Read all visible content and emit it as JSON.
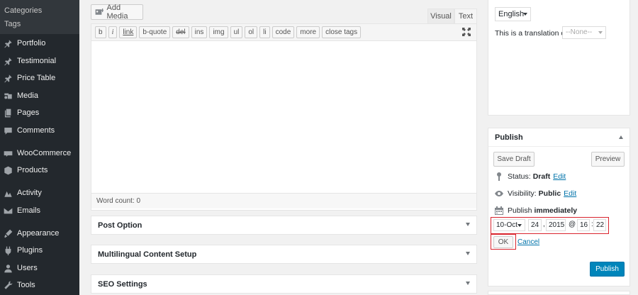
{
  "sidebar": {
    "sub_items": [
      "Categories",
      "Tags"
    ],
    "items": [
      {
        "label": "Portfolio",
        "icon": "pin-icon"
      },
      {
        "label": "Testimonial",
        "icon": "pin-icon"
      },
      {
        "label": "Price Table",
        "icon": "pin-icon"
      },
      {
        "label": "Media",
        "icon": "media-icon"
      },
      {
        "label": "Pages",
        "icon": "pages-icon"
      },
      {
        "label": "Comments",
        "icon": "comments-icon"
      },
      {
        "label": "WooCommerce",
        "icon": "woocommerce-icon"
      },
      {
        "label": "Products",
        "icon": "products-icon"
      },
      {
        "label": "Activity",
        "icon": "activity-icon"
      },
      {
        "label": "Emails",
        "icon": "email-icon"
      },
      {
        "label": "Appearance",
        "icon": "appearance-icon"
      },
      {
        "label": "Plugins",
        "icon": "plugins-icon"
      },
      {
        "label": "Users",
        "icon": "users-icon"
      },
      {
        "label": "Tools",
        "icon": "tools-icon"
      }
    ]
  },
  "editor": {
    "add_media_label": "Add Media",
    "tab_visual": "Visual",
    "tab_text": "Text",
    "toolbar": [
      "b",
      "i",
      "link",
      "b-quote",
      "del",
      "ins",
      "img",
      "ul",
      "ol",
      "li",
      "code",
      "more",
      "close tags"
    ],
    "word_count": "Word count: 0"
  },
  "postboxes": {
    "post_option": "Post Option",
    "multilingual": "Multilingual Content Setup",
    "seo": "SEO Settings"
  },
  "language": {
    "selected": "English",
    "translation_label": "This is a translation of",
    "translation_value": "--None--"
  },
  "publish": {
    "title": "Publish",
    "save_draft": "Save Draft",
    "preview": "Preview",
    "status_label": "Status:",
    "status_value": "Draft",
    "visibility_label": "Visibility:",
    "visibility_value": "Public",
    "edit_link": "Edit",
    "publish_label": "Publish",
    "publish_value": "immediately",
    "month": "10-Oct",
    "day": "24",
    "year": "2015",
    "at": "@",
    "hour": "16",
    "minute": "22",
    "comma": ",",
    "colon": ":",
    "ok": "OK",
    "cancel": "Cancel",
    "publish_button": "Publish"
  },
  "colors": {
    "sidebar_bg": "#23282d",
    "primary_button": "#0085ba",
    "link": "#0073aa",
    "highlight_frame": "#d9232d"
  }
}
